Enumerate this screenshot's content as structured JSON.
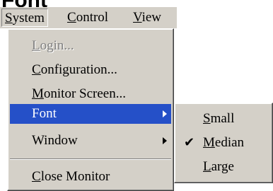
{
  "header": {
    "title": "Font"
  },
  "menubar": {
    "items": [
      {
        "label": "System",
        "mnemonic": "S",
        "rest": "ystem"
      },
      {
        "label": "Control",
        "mnemonic": "C",
        "rest": "ontrol"
      },
      {
        "label": "View",
        "mnemonic": "V",
        "rest": "iew"
      }
    ]
  },
  "system_menu": {
    "login": {
      "mnemonic": "L",
      "rest": "ogin...",
      "disabled": true
    },
    "configuration": {
      "mnemonic": "C",
      "rest": "onfiguration..."
    },
    "monitor_screen": {
      "mnemonic": "M",
      "rest": "onitor Screen..."
    },
    "font": {
      "label": "Font",
      "highlighted": true,
      "has_submenu": true
    },
    "window": {
      "label": "Window",
      "has_submenu": true
    },
    "close_monitor": {
      "mnemonic": "C",
      "rest": "lose Monitor"
    }
  },
  "font_submenu": {
    "items": [
      {
        "mnemonic": "S",
        "rest": "mall",
        "checked": false
      },
      {
        "mnemonic": "M",
        "rest": "edian",
        "checked": true
      },
      {
        "mnemonic": "L",
        "rest": "arge",
        "checked": false
      }
    ],
    "check_glyph": "✔"
  }
}
